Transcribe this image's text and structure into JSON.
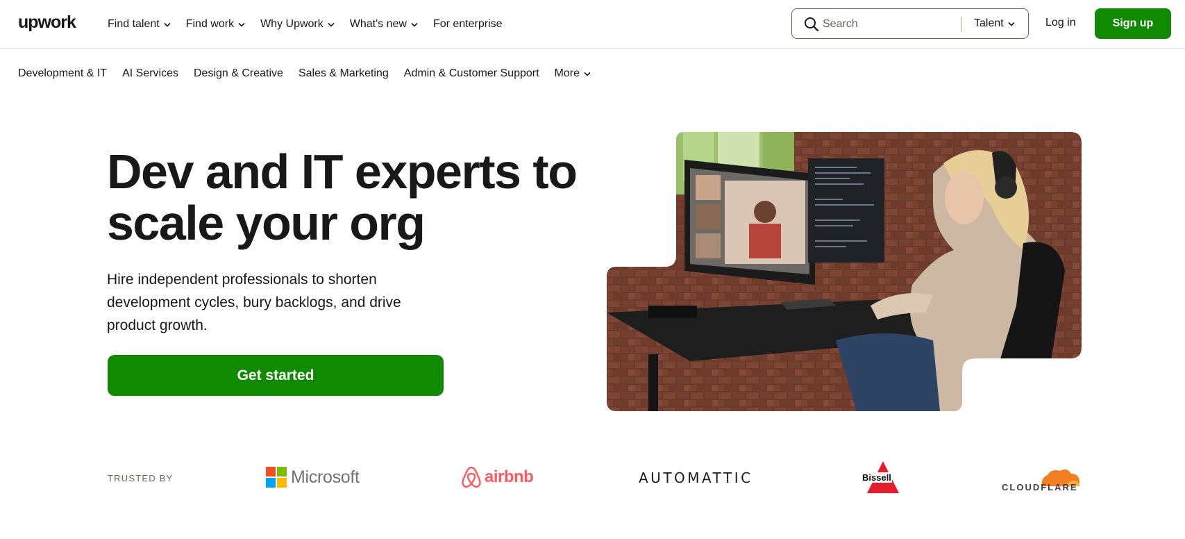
{
  "header": {
    "logo_text": "upwork",
    "nav": [
      {
        "label": "Find talent",
        "has_dropdown": true
      },
      {
        "label": "Find work",
        "has_dropdown": true
      },
      {
        "label": "Why Upwork",
        "has_dropdown": true
      },
      {
        "label": "What's new",
        "has_dropdown": true
      },
      {
        "label": "For enterprise",
        "has_dropdown": false
      }
    ],
    "search": {
      "placeholder": "Search",
      "value": "",
      "scope": "Talent"
    },
    "login_label": "Log in",
    "signup_label": "Sign up"
  },
  "categories": [
    {
      "label": "Development & IT"
    },
    {
      "label": "AI Services"
    },
    {
      "label": "Design & Creative"
    },
    {
      "label": "Sales & Marketing"
    },
    {
      "label": "Admin & Customer Support"
    },
    {
      "label": "More",
      "has_dropdown": true
    }
  ],
  "hero": {
    "title_line1": "Dev and IT experts to",
    "title_line2": "scale your org",
    "subtitle": "Hire independent professionals to shorten development cycles, bury backlogs, and drive product growth.",
    "cta_label": "Get started"
  },
  "trusted": {
    "label": "TRUSTED BY",
    "brands": [
      {
        "name": "Microsoft"
      },
      {
        "name": "airbnb"
      },
      {
        "name": "AUTOMATTIC"
      },
      {
        "name": "Bissell"
      },
      {
        "name": "CLOUDFLARE"
      }
    ]
  },
  "colors": {
    "brand_green": "#108a00",
    "text_dark": "#181818",
    "muted_green_gray": "#5e6d55",
    "airbnb_red": "#ff5a5f",
    "cloudflare_orange": "#f38020",
    "bissell_red": "#e31d2b"
  },
  "icons": [
    "search-icon",
    "chevron-down-icon",
    "upwork-logo",
    "microsoft-logo",
    "airbnb-logo",
    "automattic-logo",
    "bissell-logo",
    "cloudflare-logo"
  ]
}
